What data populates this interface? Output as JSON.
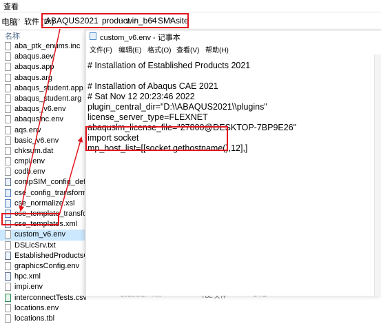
{
  "explorer": {
    "menu_label": "查看",
    "breadcrumb": {
      "prefix": "电脑",
      "items": [
        "软件 (D:)",
        "ABAQUS2021",
        "product",
        "win_b64",
        "SMA",
        "site"
      ]
    },
    "column_header": "名称",
    "files": [
      {
        "name": "aba_ptk_enums.inc",
        "type": "doc"
      },
      {
        "name": "abaqus.aev",
        "type": "doc"
      },
      {
        "name": "abaqus.app",
        "type": "doc"
      },
      {
        "name": "abaqus.arg",
        "type": "doc"
      },
      {
        "name": "abaqus_student.app",
        "type": "doc"
      },
      {
        "name": "abaqus_student.arg",
        "type": "doc"
      },
      {
        "name": "abaqus_v6.env",
        "type": "doc"
      },
      {
        "name": "abaqusinc.env",
        "type": "doc"
      },
      {
        "name": "aqs.env",
        "type": "doc"
      },
      {
        "name": "basic_v6.env",
        "type": "doc"
      },
      {
        "name": "chksum.dat",
        "type": "doc"
      },
      {
        "name": "cmpi.env",
        "type": "doc"
      },
      {
        "name": "codb.env",
        "type": "doc"
      },
      {
        "name": "compSIM_config_default.xml",
        "type": "cfg"
      },
      {
        "name": "cse_config_transform.xsl",
        "type": "xls"
      },
      {
        "name": "cse_normalize.xsl",
        "type": "xls"
      },
      {
        "name": "cse_template_transform.xsl",
        "type": "xls"
      },
      {
        "name": "cse_templates.xml",
        "type": "cfg"
      },
      {
        "name": "custom_v6.env",
        "type": "doc"
      },
      {
        "name": "DSLicSrv.txt",
        "type": "doc"
      },
      {
        "name": "EstablishedProductsConfig.ini",
        "type": "cfg"
      },
      {
        "name": "graphicsConfig.env",
        "type": "doc"
      },
      {
        "name": "hpc.xml",
        "type": "cfg"
      },
      {
        "name": "impi.env",
        "type": "doc"
      },
      {
        "name": "interconnectTests.csv",
        "type": "csv"
      },
      {
        "name": "locations.env",
        "type": "doc"
      },
      {
        "name": "locations.tbl",
        "type": "doc"
      }
    ],
    "selected_index": 18,
    "bottom_details": {
      "date": "2015/5/27 4:00",
      "type": "TBL 文件",
      "size": "2 KB"
    }
  },
  "notepad": {
    "title": "custom_v6.env - 记事本",
    "menu": [
      "文件(F)",
      "编辑(E)",
      "格式(O)",
      "查看(V)",
      "帮助(H)"
    ],
    "lines": [
      "# Installation of Established Products 2021",
      "",
      "# Installation of Abaqus CAE 2021",
      "# Sat Nov 12 20:23:46 2022",
      "plugin_central_dir=\"D:\\\\ABAQUS2021\\\\plugins\"",
      "license_server_type=FLEXNET",
      "abaquslm_license_file=\"27800@DESKTOP-7BP9E26\"",
      "import socket",
      "mp_host_list=[[socket.gethostname(),12],]"
    ]
  },
  "colors": {
    "highlight": "#e1161e",
    "selection": "#cce8ff"
  }
}
